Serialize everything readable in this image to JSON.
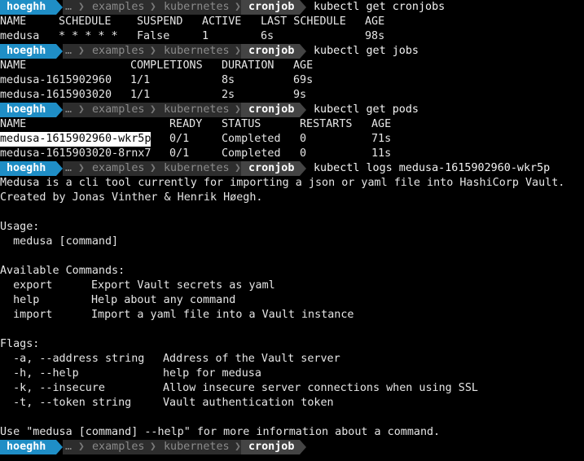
{
  "prompt": {
    "user": "hoeghh",
    "ellipsis": "…",
    "dirs": [
      "examples",
      "kubernetes"
    ],
    "current": "cronjob",
    "colors": {
      "user_bg": "#1f8ec6",
      "path_bg": "#2d2d2d",
      "current_bg": "#444444"
    }
  },
  "commands": [
    "kubectl get cronjobs",
    "kubectl get jobs",
    "kubectl get pods",
    "kubectl logs medusa-1615902960-wkr5p"
  ],
  "cronjobs": {
    "headers": [
      "NAME",
      "SCHEDULE",
      "SUSPEND",
      "ACTIVE",
      "LAST SCHEDULE",
      "AGE"
    ],
    "rows": [
      [
        "medusa",
        "* * * * *",
        "False",
        "1",
        "6s",
        "98s"
      ]
    ]
  },
  "jobs": {
    "headers": [
      "NAME",
      "COMPLETIONS",
      "DURATION",
      "AGE"
    ],
    "rows": [
      [
        "medusa-1615902960",
        "1/1",
        "8s",
        "69s"
      ],
      [
        "medusa-1615903020",
        "1/1",
        "2s",
        "9s"
      ]
    ]
  },
  "pods": {
    "headers": [
      "NAME",
      "READY",
      "STATUS",
      "RESTARTS",
      "AGE"
    ],
    "rows": [
      [
        "medusa-1615902960-wkr5p",
        "0/1",
        "Completed",
        "0",
        "71s"
      ],
      [
        "medusa-1615903020-8rnx7",
        "0/1",
        "Completed",
        "0",
        "11s"
      ]
    ]
  },
  "logs": {
    "intro1": "Medusa is a cli tool currently for importing a json or yaml file into HashiCorp Vault.",
    "intro2": "Created by Jonas Vinther & Henrik Høegh.",
    "usage_title": "Usage:",
    "usage": "  medusa [command]",
    "commands_title": "Available Commands:",
    "commands": [
      [
        "  export",
        "Export Vault secrets as yaml"
      ],
      [
        "  help",
        "Help about any command"
      ],
      [
        "  import",
        "Import a yaml file into a Vault instance"
      ]
    ],
    "flags_title": "Flags:",
    "flags": [
      [
        "  -a, --address string",
        "Address of the Vault server"
      ],
      [
        "  -h, --help",
        "help for medusa"
      ],
      [
        "  -k, --insecure",
        "Allow insecure server connections when using SSL"
      ],
      [
        "  -t, --token string",
        "Vault authentication token"
      ]
    ],
    "footer": "Use \"medusa [command] --help\" for more information about a command."
  }
}
